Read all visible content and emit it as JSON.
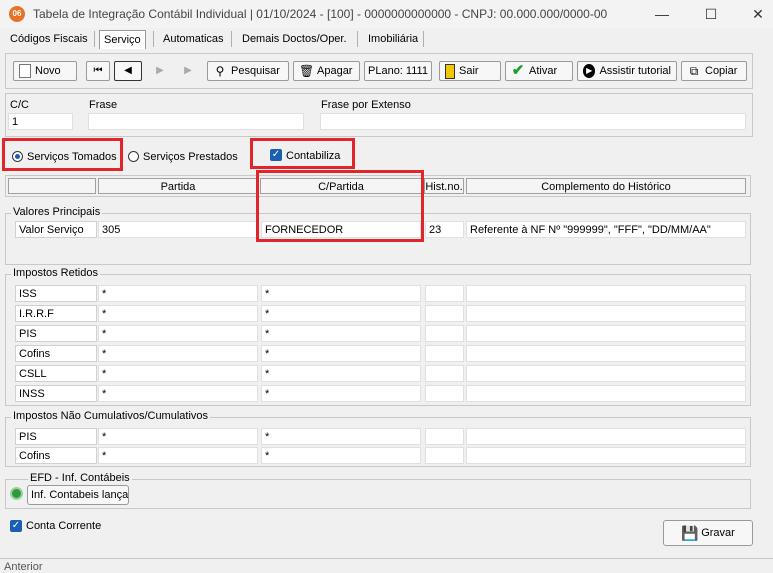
{
  "window": {
    "app_icon_text": "06",
    "title": "Tabela de Integração Contábil Individual  |  01/10/2024 - [100] - 0000000000000 - CNPJ: 00.000.000/0000-00",
    "minimize": "—",
    "maximize": "☐",
    "close": "✕"
  },
  "tabs": [
    "Códigos Fiscais",
    "Serviço",
    "Automaticas",
    "Demais Doctos/Oper.",
    "Imobiliária"
  ],
  "toolbar": {
    "novo": "Novo",
    "pesquisar": "Pesquisar",
    "apagar": "Apagar",
    "plano": "PLano: 1111",
    "sair": "Sair",
    "ativar": "Ativar",
    "assistir": "Assistir tutorial",
    "copiar": "Copiar"
  },
  "header_fields": {
    "cc_label": "C/C",
    "cc_value": "1",
    "frase_label": "Frase",
    "frase_value": "",
    "frase_extenso_label": "Frase por Extenso",
    "frase_extenso_value": ""
  },
  "options": {
    "servicos_tomados": "Serviços Tomados",
    "servicos_prestados": "Serviços Prestados",
    "contabiliza": "Contabiliza",
    "selected": "servicos_tomados",
    "contabiliza_checked": true
  },
  "columns": [
    "",
    "Partida",
    "C/Partida",
    "Hist.no.",
    "Complemento do Histórico"
  ],
  "valores_principais": {
    "title": "Valores Principais",
    "rows": [
      {
        "label": "Valor Serviço",
        "partida": "305",
        "cpartida": "FORNECEDOR",
        "hist": "23",
        "complemento": "Referente à NF Nº \"999999\", \"FFF\", \"DD/MM/AA\""
      }
    ]
  },
  "impostos_retidos": {
    "title": "Impostos Retidos",
    "rows": [
      {
        "label": "ISS",
        "partida": "*",
        "cpartida": "*",
        "hist": "",
        "complemento": ""
      },
      {
        "label": "I.R.R.F",
        "partida": "*",
        "cpartida": "*",
        "hist": "",
        "complemento": ""
      },
      {
        "label": "PIS",
        "partida": "*",
        "cpartida": "*",
        "hist": "",
        "complemento": ""
      },
      {
        "label": "Cofins",
        "partida": "*",
        "cpartida": "*",
        "hist": "",
        "complemento": ""
      },
      {
        "label": "CSLL",
        "partida": "*",
        "cpartida": "*",
        "hist": "",
        "complemento": ""
      },
      {
        "label": "INSS",
        "partida": "*",
        "cpartida": "*",
        "hist": "",
        "complemento": ""
      }
    ]
  },
  "impostos_nao_cumulativos": {
    "title": "Impostos Não Cumulativos/Cumulativos",
    "rows": [
      {
        "label": "PIS",
        "partida": "*",
        "cpartida": "*",
        "hist": "",
        "complemento": ""
      },
      {
        "label": "Cofins",
        "partida": "*",
        "cpartida": "*",
        "hist": "",
        "complemento": ""
      }
    ]
  },
  "efd": {
    "title": "EFD - Inf. Contábeis",
    "button": "Inf. Contabeis lançad"
  },
  "conta_corrente": {
    "label": "Conta Corrente",
    "checked": true
  },
  "gravar": "Gravar",
  "status": "Anterior",
  "colors": {
    "highlight": "#e0262a",
    "check": "#1a5fb4"
  }
}
